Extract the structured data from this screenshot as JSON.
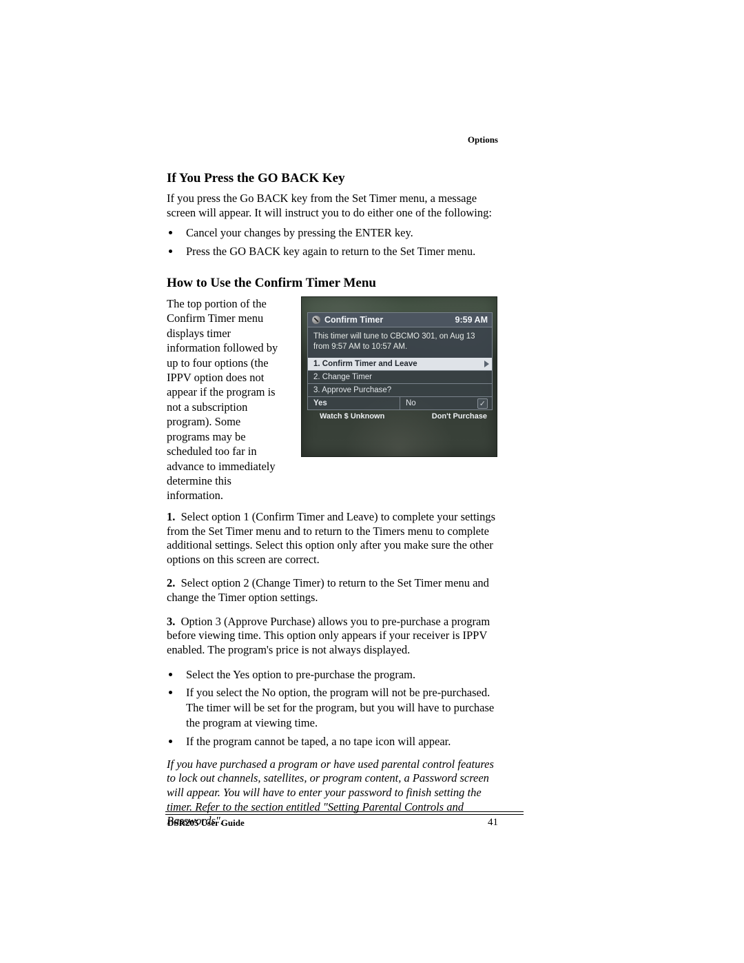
{
  "header": {
    "section_label": "Options"
  },
  "section1": {
    "heading": "If You Press the GO BACK Key",
    "intro": "If you press the Go BACK key from the Set Timer menu, a message screen will appear. It will instruct you to do either one of the following:",
    "bullets": [
      "Cancel your changes by pressing the ENTER key.",
      "Press the GO BACK key again to return to the Set Timer menu."
    ]
  },
  "section2": {
    "heading": "How to Use the Confirm Timer Menu",
    "left_para": "The top portion of the Confirm Timer menu displays timer information followed by up to four options (the IPPV option does not appear if the program is not a subscription program). Some programs may be scheduled too far in advance to immediately determine this information.",
    "steps": [
      "Select option 1 (Confirm Timer and Leave) to complete your settings from the Set Timer menu and to return to the Timers menu to complete additional settings. Select this option only after you make sure the other options on this screen are correct.",
      "Select option 2 (Change Timer) to return to the Set Timer menu and change the Timer option settings.",
      "Option 3 (Approve Purchase) allows you to pre-purchase a program before viewing time. This option only appears if your receiver is IPPV enabled. The program's price is not always displayed."
    ],
    "sub_bullets": [
      "Select the Yes option to pre-purchase the program.",
      "If you select the No option, the program will not be pre-purchased. The timer will be set for the program, but you will have to purchase the program at viewing time.",
      "If the program cannot be taped, a no tape icon will appear."
    ],
    "note": "If you have purchased a program or have used parental control features to lock out channels, satellites, or program content, a Password screen will appear. You will have to enter your password to finish setting the timer. Refer to the section entitled \"Setting Parental Controls and Passwords\"."
  },
  "dialog": {
    "title": "Confirm Timer",
    "time": "9:59 AM",
    "description": "This timer will tune to CBCMO 301, on Aug 13 from 9:57 AM to 10:57 AM.",
    "items": [
      "1.  Confirm Timer and Leave",
      "2.  Change Timer",
      "3.  Approve Purchase?"
    ],
    "yes_label": "Yes",
    "no_label": "No",
    "yes_sub": "Watch $ Unknown",
    "no_sub": "Don't Purchase"
  },
  "footer": {
    "guide": "DSR205 User Guide",
    "page": "41"
  }
}
